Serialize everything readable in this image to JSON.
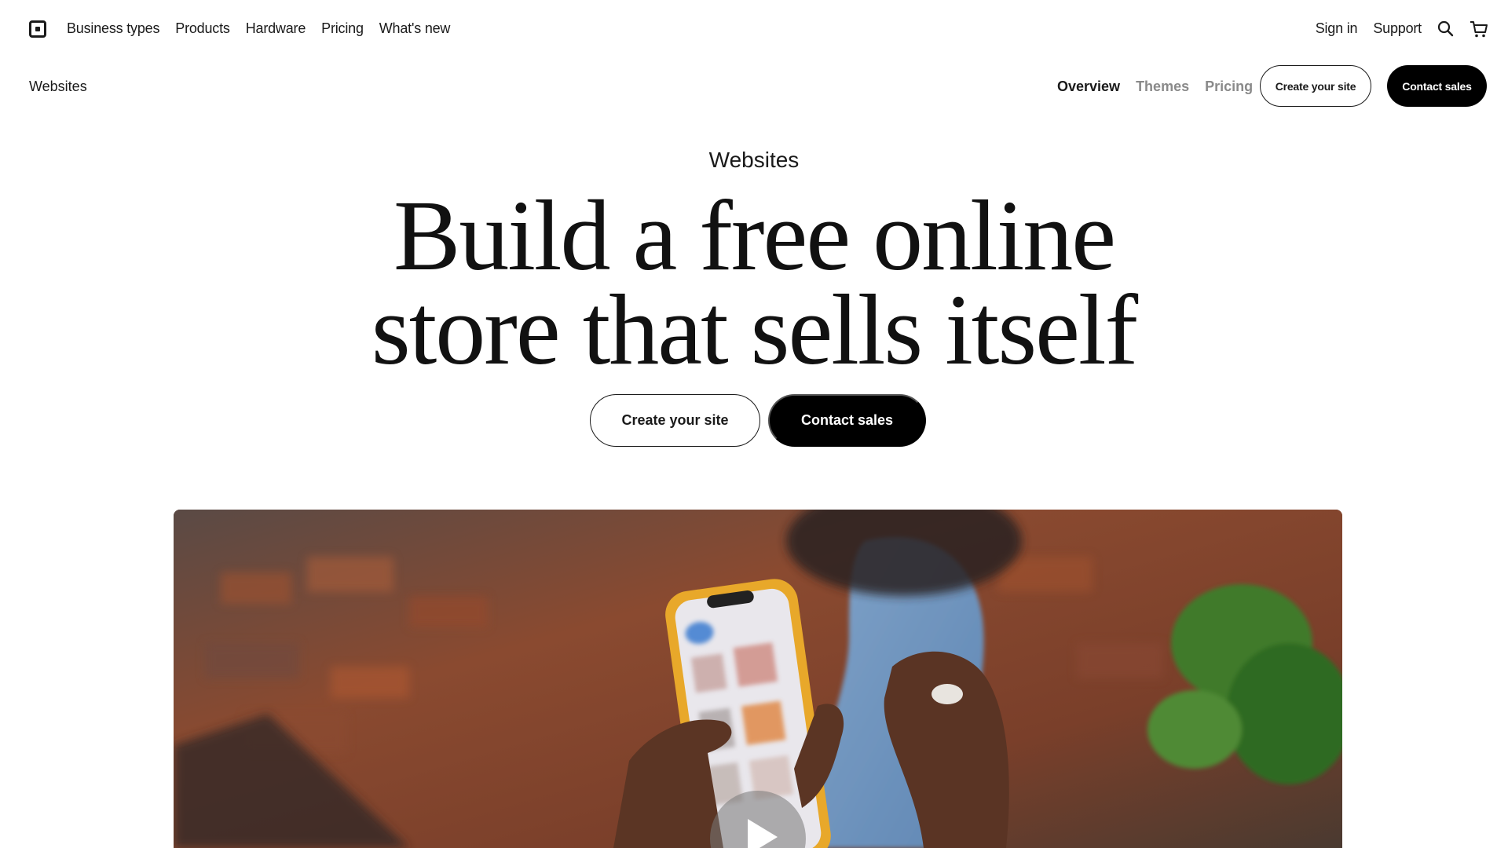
{
  "topnav": {
    "logo_icon": "square-logo-icon",
    "links": [
      "Business types",
      "Products",
      "Hardware",
      "Pricing",
      "What's new"
    ],
    "right_links": [
      "Sign in",
      "Support"
    ],
    "search_icon": "search-icon",
    "cart_icon": "cart-icon"
  },
  "subnav": {
    "title": "Websites",
    "links": [
      {
        "label": "Overview",
        "active": true
      },
      {
        "label": "Themes",
        "active": false
      },
      {
        "label": "Pricing",
        "active": false
      }
    ],
    "create_label": "Create your site",
    "contact_label": "Contact sales"
  },
  "hero": {
    "eyebrow": "Websites",
    "headline_line1": "Build a free online",
    "headline_line2": "store that sells itself",
    "create_label": "Create your site",
    "contact_label": "Contact sales"
  },
  "video": {
    "play_icon": "play-icon"
  },
  "colors": {
    "text": "#1a1a1a",
    "muted": "#8a8a8a",
    "button_dark": "#000000",
    "background": "#ffffff"
  }
}
